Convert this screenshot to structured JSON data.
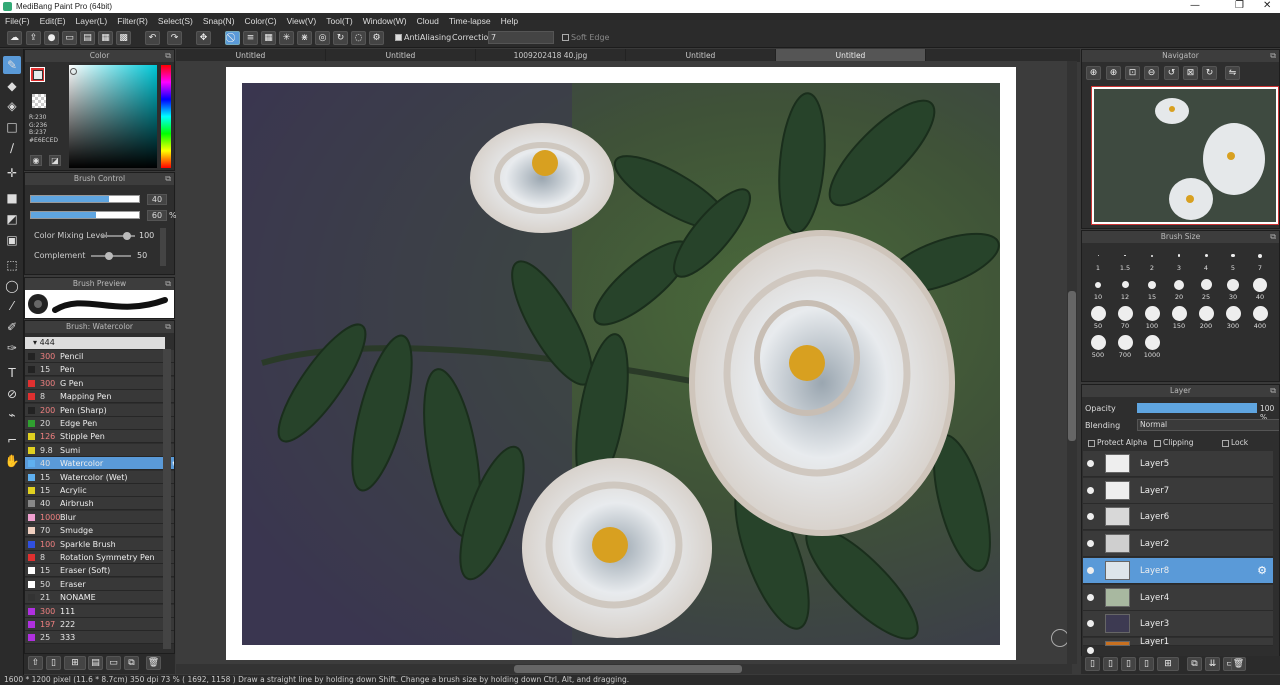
{
  "window": {
    "title": "MediBang Paint Pro (64bit)",
    "min": "—",
    "max": "❐",
    "close": "✕"
  },
  "menu": [
    "File(F)",
    "Edit(E)",
    "Layer(L)",
    "Filter(R)",
    "Select(S)",
    "Snap(N)",
    "Color(C)",
    "View(V)",
    "Tool(T)",
    "Window(W)",
    "Cloud",
    "Time-lapse",
    "Help"
  ],
  "toolbar": {
    "antialiasing": "AntiAliasing",
    "correction_label": "Correction",
    "correction_value": "7",
    "soft_edge": "Soft Edge"
  },
  "tabs": [
    "Untitled",
    "Untitled",
    "1009202418 40.jpg",
    "Untitled",
    "Untitled"
  ],
  "color_panel": {
    "title": "Color",
    "r": "R:230",
    "g": "G:236",
    "b": "B:237",
    "hex": "#E6ECED",
    "primary": "#E6ECED"
  },
  "brush_control": {
    "title": "Brush Control",
    "size": "40",
    "opacity": "60",
    "opacity_unit": "%",
    "mixing_label": "Color Mixing Level",
    "mixing_value": "100",
    "complement_label": "Complement",
    "complement_value": "50",
    "size_fill": 0.72,
    "opacity_fill": 0.6
  },
  "brush_preview": {
    "title": "Brush Preview"
  },
  "brush_list": {
    "title": "Brush: Watercolor",
    "group": "444",
    "items": [
      {
        "size": "300",
        "name": "Pencil",
        "color": "#222222"
      },
      {
        "size": "15",
        "name": "Pen",
        "color": "#222222"
      },
      {
        "size": "300",
        "name": "G Pen",
        "color": "#e03030"
      },
      {
        "size": "8",
        "name": "Mapping Pen",
        "color": "#e03030"
      },
      {
        "size": "200",
        "name": "Pen (Sharp)",
        "color": "#222222"
      },
      {
        "size": "20",
        "name": "Edge Pen",
        "color": "#30a030"
      },
      {
        "size": "126",
        "name": "Stipple Pen",
        "color": "#e0d020"
      },
      {
        "size": "9.8",
        "name": "Sumi",
        "color": "#e0d020"
      },
      {
        "size": "40",
        "name": "Watercolor",
        "color": "#5fb0f0"
      },
      {
        "size": "15",
        "name": "Watercolor (Wet)",
        "color": "#5fb0f0"
      },
      {
        "size": "15",
        "name": "Acrylic",
        "color": "#e0d020"
      },
      {
        "size": "40",
        "name": "Airbrush",
        "color": "#888888"
      },
      {
        "size": "1000",
        "name": "Blur",
        "color": "#f0a0d0"
      },
      {
        "size": "70",
        "name": "Smudge",
        "color": "#f0d0c0"
      },
      {
        "size": "100",
        "name": "Sparkle Brush",
        "color": "#3050e0"
      },
      {
        "size": "8",
        "name": "Rotation Symmetry Pen",
        "color": "#e03030"
      },
      {
        "size": "15",
        "name": "Eraser (Soft)",
        "color": "#ffffff"
      },
      {
        "size": "50",
        "name": "Eraser",
        "color": "#ffffff"
      },
      {
        "size": "21",
        "name": "NONAME",
        "color": "#333333"
      },
      {
        "size": "300",
        "name": "111",
        "color": "#b030e0"
      },
      {
        "size": "197",
        "name": "222",
        "color": "#b030e0"
      },
      {
        "size": "25",
        "name": "333",
        "color": "#b030e0"
      }
    ]
  },
  "navigator": {
    "title": "Navigator"
  },
  "brush_size": {
    "title": "Brush Size",
    "sizes": [
      "1",
      "1.5",
      "2",
      "3",
      "4",
      "5",
      "7",
      "10",
      "12",
      "15",
      "20",
      "25",
      "30",
      "40",
      "50",
      "70",
      "100",
      "150",
      "200",
      "300",
      "400",
      "500",
      "700",
      "1000"
    ]
  },
  "layer_panel": {
    "title": "Layer",
    "opacity_label": "Opacity",
    "opacity_value": "100 %",
    "blending_label": "Blending",
    "blending_value": "Normal",
    "protect_alpha": "Protect Alpha",
    "clipping": "Clipping",
    "lock": "Lock",
    "layers": [
      {
        "name": "Layer5",
        "thumb": "#eeeeee"
      },
      {
        "name": "Layer7",
        "thumb": "#eeeeee"
      },
      {
        "name": "Layer6",
        "thumb": "#d8d8d8"
      },
      {
        "name": "Layer2",
        "thumb": "#cfcfcf"
      },
      {
        "name": "Layer8",
        "thumb": "#dde5ea"
      },
      {
        "name": "Layer4",
        "thumb": "#a8b8a0"
      },
      {
        "name": "Layer3",
        "thumb": "#3d3a52"
      },
      {
        "name": "Layer1",
        "thumb": "#c87020"
      }
    ]
  },
  "status": "1600 * 1200 pixel   (11.6 * 8.7cm)   350 dpi   73 %   ( 1692, 1158 )   Draw a straight line by holding down Shift. Change a brush size by holding down Ctrl, Alt, and dragging."
}
